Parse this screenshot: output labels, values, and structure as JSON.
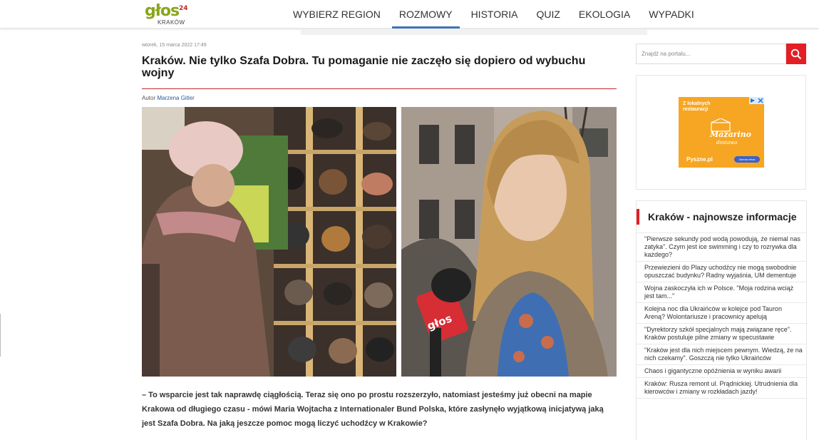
{
  "header": {
    "logo": {
      "brand": "głos",
      "sup": "24",
      "city": "KRAKÓW"
    },
    "nav": [
      {
        "label": "WYBIERZ REGION",
        "active": false
      },
      {
        "label": "ROZMOWY",
        "active": true
      },
      {
        "label": "HISTORIA",
        "active": false
      },
      {
        "label": "QUIZ",
        "active": false
      },
      {
        "label": "EKOLOGIA",
        "active": false
      },
      {
        "label": "WYPADKI",
        "active": false
      }
    ]
  },
  "article": {
    "date": "wtorek, 15 marca 2022 17:49",
    "title": "Kraków. Nie tylko Szafa Dobra. Tu pomaganie nie zaczęło się dopiero od wybuchu wojny",
    "author_prefix": "Autor",
    "author_name": "Marzena Gitler",
    "microphone_logo": "głos",
    "lead": "– To wsparcie jest tak naprawdę ciągłością. Teraz się ono po prostu rozszerzyło, natomiast jesteśmy już obecni na mapie Krakowa od długiego czasu - mówi Maria Wojtacha z Internationaler Bund Polska, które zasłynęło wyjątkową inicjatywą jaką jest Szafa Dobra. Na jaką jeszcze pomoc mogą liczyć uchodźcy w Krakowie?"
  },
  "sidebar": {
    "search_placeholder": "Znajdź na portalu...",
    "ad": {
      "top_text": "Z lokalnych restauracji",
      "brand": "Mazarino",
      "tagline": "dostawa",
      "pyszne": "Pyszne.pl",
      "order_label": "Zamów teraz"
    },
    "news_heading": "Kraków - najnowsze informacje",
    "news": [
      "\"Pierwsze sekundy pod wodą powodują, że niemal nas zatyka\". Czym jest ice swimming i czy to rozrywka dla każdego?",
      "Przewiezieni do Plazy uchodźcy nie mogą swobodnie opuszczać budynku? Radny wyjaśnia, UM dementuje",
      "Wojna zaskoczyła ich w Polsce. \"Moja rodzina wciąż jest tam...\"",
      "Kolejna noc dla Ukraińców w kolejce pod Tauron Areną? Wolontariusze i pracownicy apelują",
      "\"Dyrektorzy szkół specjalnych mają związane ręce\". Kraków postuluje pilne zmiany w specustawie",
      "\"Kraków jest dla nich miejscem pewnym. Wiedzą, że na nich czekamy\". Goszczą nie tylko Ukraińców",
      "Chaos i gigantyczne opóźnienia w wyniku awarii",
      "Kraków: Rusza remont ul. Prądnickiej. Utrudnienia dla kierowców i zmiany w rozkładach jazdy!"
    ]
  },
  "colors": {
    "accent_red": "#e31e24",
    "nav_active": "#3e73b8",
    "logo_green": "#8aa51a",
    "ad_orange": "#f6a623"
  }
}
